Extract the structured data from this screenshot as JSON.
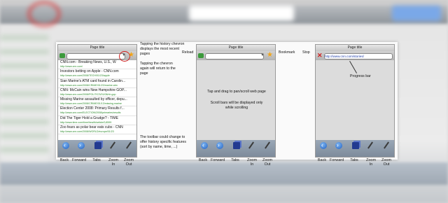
{
  "phone1": {
    "title": "Page title",
    "items": [
      {
        "title": "CNN.com - Breaking News, U.S., W",
        "url": "http://www.cnn.com/"
      },
      {
        "title": "Investors betting on Apple - CNN.com",
        "url": "http://www.cnn.com/2008/TECH/01/23/apple"
      },
      {
        "title": "Sian Marine's ATM card found in Carolin...",
        "url": "http://www.cnn.com/2008/CRIME/01/23/marine.atm"
      },
      {
        "title": "CNN: McCain wins New Hampshire GOP...",
        "url": "http://www.cnn.com/2008/POLITICS/01/08/nh.gop"
      },
      {
        "title": "Missing Marine assaulted by officer, depu...",
        "url": "http://www.cnn.com/2008/CRIME/01/13/missing.marine"
      },
      {
        "title": "Election Center 2008: Primary Results f...",
        "url": "http://www.cnn.com/ELECTION/2008/primaries/results"
      },
      {
        "title": "Did The Tiger Hold a Grudge? - TIME",
        "url": "http://www.time.com/time/health/article/0,8599"
      },
      {
        "title": "Zoo fears as polar bear eats cubs - CNN",
        "url": "http://www.cnn.com/2008/WORLD/europe/01/23"
      }
    ]
  },
  "phone2": {
    "title": "Page title"
  },
  "phone3": {
    "title": "Page title",
    "url": "http://www.cnn.com/stories/"
  },
  "toolbar": {
    "back": "Back",
    "forward": "Forward",
    "tabs": "Tabs",
    "zoom_in_1": "Zoom",
    "zoom_in_2": "In",
    "zoom_out_1": "Zoom",
    "zoom_out_2": "Out"
  },
  "notes": {
    "history": "Tapping the history chevron displays the most recent pages",
    "history_return": "Tapping the chevron again will return to the page",
    "toolbar_change": "The toolbar could change to offer history specific features (sort by name, time, ...)",
    "reload": "Reload",
    "bookmark": "Bookmark",
    "stop": "Stop",
    "pan": "Tap and drag to pan/scroll web page",
    "scrollbars": "Scroll bars will be displayed only while scrolling",
    "progress": "Progress bar"
  },
  "colors": {
    "accent": "#1f5fc2",
    "star": "#f2a51a",
    "circle": "#d12020",
    "url": "#2a8a2a"
  }
}
